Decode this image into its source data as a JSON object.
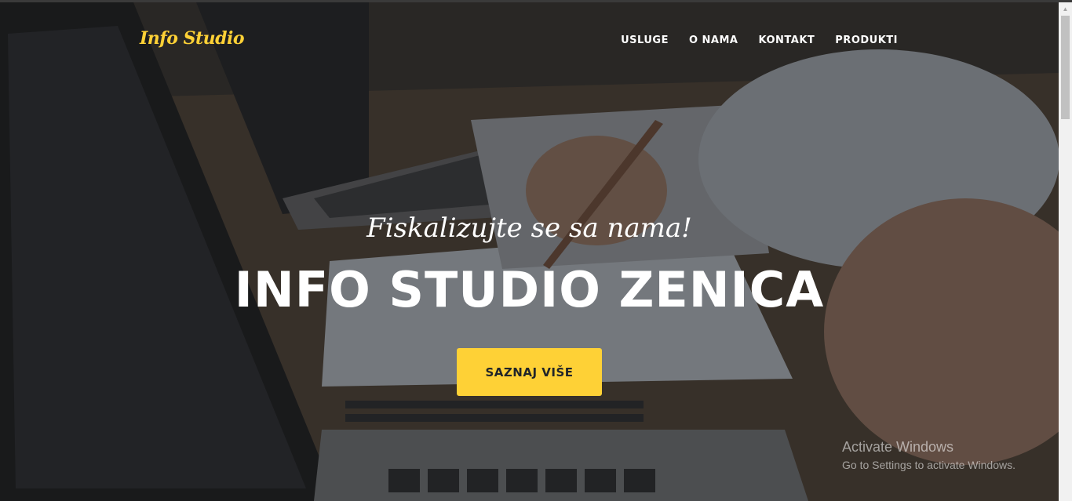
{
  "nav": {
    "brand": "Info Studio",
    "items": [
      {
        "label": "USLUGE"
      },
      {
        "label": "O NAMA"
      },
      {
        "label": "KONTAKT"
      },
      {
        "label": "PRODUKTI"
      }
    ]
  },
  "hero": {
    "subheading": "Fiskalizujte se sa nama!",
    "heading": "INFO STUDIO ZENICA",
    "cta_label": "SAZNAJ VIŠE"
  },
  "watermark": {
    "title": "Activate Windows",
    "subtitle": "Go to Settings to activate Windows."
  },
  "colors": {
    "accent": "#fed136",
    "text": "#ffffff",
    "button_text": "#212529"
  },
  "icons": {
    "scroll_up": "triangle-up-icon"
  }
}
